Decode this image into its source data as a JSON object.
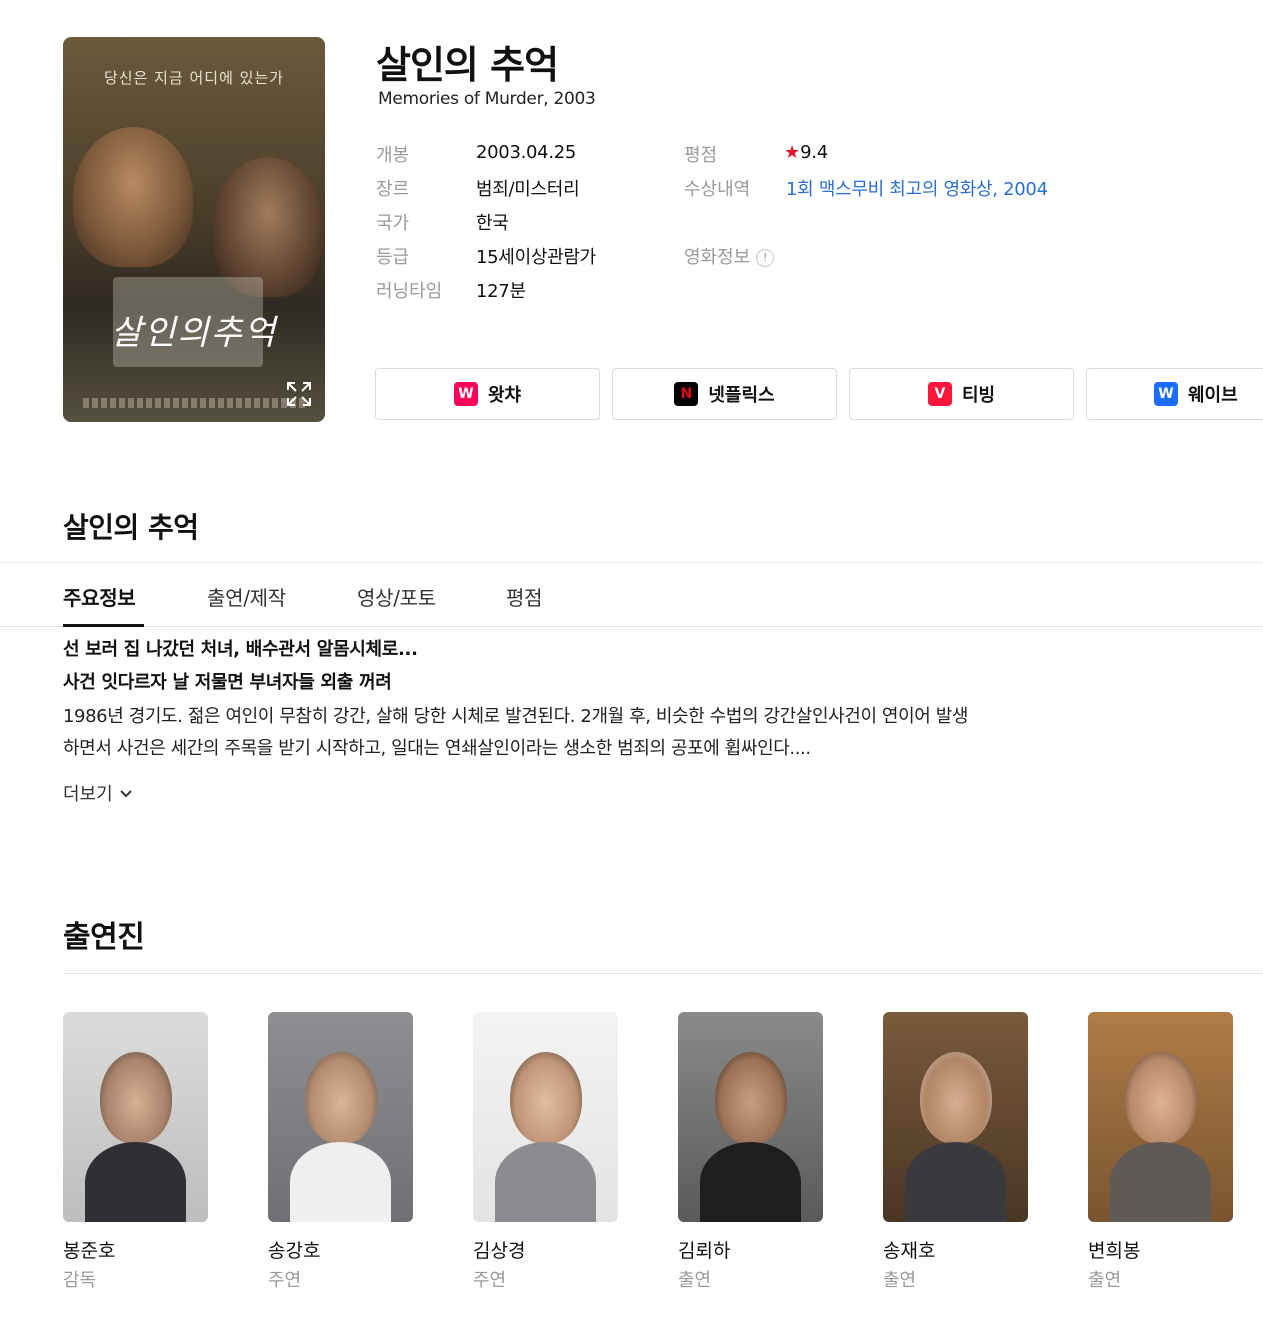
{
  "movie": {
    "title": "살인의 추억",
    "subtitle": "Memories of Murder, 2003",
    "poster": {
      "tagline": "당신은 지금 어디에 있는가",
      "title_art": "살인의추억",
      "expand_icon": "expand-icon"
    }
  },
  "info": {
    "release_label": "개봉",
    "release_value": "2003.04.25",
    "genre_label": "장르",
    "genre_value": "범죄/미스터리",
    "country_label": "국가",
    "country_value": "한국",
    "rating_label": "등급",
    "rating_value": "15세이상관람가",
    "runtime_label": "러닝타임",
    "runtime_value": "127분",
    "score_label": "평점",
    "score_value": "9.4",
    "awards_label": "수상내역",
    "awards_value": "1회 맥스무비 최고의 영화상, 2004",
    "movieinfo_label": "영화정보"
  },
  "ott": [
    {
      "name": "왓챠",
      "logo": "W",
      "color": "#ff0558"
    },
    {
      "name": "넷플릭스",
      "logo": "N",
      "color": "#000000"
    },
    {
      "name": "티빙",
      "logo": "V",
      "color": "#ff153c"
    },
    {
      "name": "웨이브",
      "logo": "W",
      "color": "#1a6dff"
    }
  ],
  "section": {
    "title": "살인의 추억",
    "tabs": [
      "주요정보",
      "출연/제작",
      "영상/포토",
      "평점"
    ]
  },
  "synopsis": {
    "headline1": "선 보러 집 나갔던 처녀, 배수관서 알몸시체로...",
    "headline2": "사건 잇다르자 날 저물면 부녀자들 외출 꺼려",
    "line1": "1986년 경기도. 젊은 여인이 무참히 강간, 살해 당한 시체로 발견된다. 2개월 후, 비슷한 수법의 강간살인사건이 연이어 발생",
    "line2": "하면서 사건은 세간의 주목을 받기 시작하고, 일대는 연쇄살인이라는 생소한 범죄의 공포에 휩싸인다....",
    "more_label": "더보기"
  },
  "cast": {
    "title": "출연진",
    "members": [
      {
        "name": "봉준호",
        "role": "감독"
      },
      {
        "name": "송강호",
        "role": "주연"
      },
      {
        "name": "김상경",
        "role": "주연"
      },
      {
        "name": "김뢰하",
        "role": "출연"
      },
      {
        "name": "송재호",
        "role": "출연"
      },
      {
        "name": "변희봉",
        "role": "출연"
      }
    ]
  },
  "colors": {
    "link": "#2a6fd1",
    "star": "#e3182d",
    "muted": "#9a9a9a"
  }
}
